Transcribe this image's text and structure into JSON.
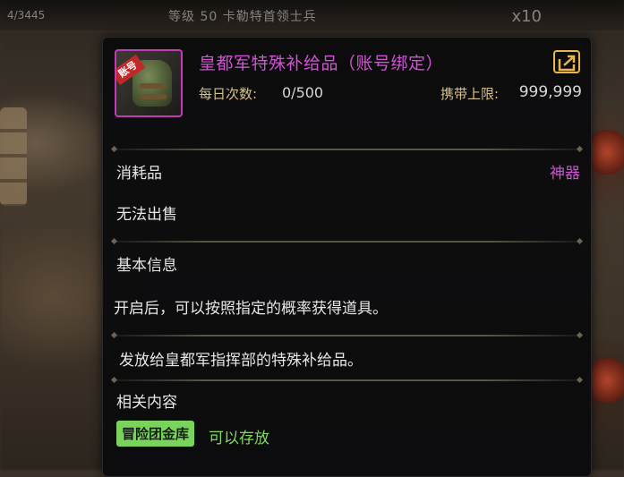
{
  "background": {
    "top_left_text": "4/3445",
    "top_center_text": "等级 50 卡勒特首领士兵",
    "top_right_text": "x10"
  },
  "item": {
    "icon_name": "backpack-icon",
    "tag": "账号",
    "title": "皇都军特殊补给品（账号绑定）",
    "title_color": "#d152d6",
    "daily_label": "每日次数:",
    "daily_value": "0/500",
    "carry_label": "携带上限:",
    "carry_value": "999,999"
  },
  "sections": {
    "type": "消耗品",
    "rarity": "神器",
    "sell": "无法出售",
    "basic_info_header": "基本信息",
    "basic_info_text": "开启后，可以按照指定的概率获得道具。",
    "description": "发放给皇都军指挥部的特殊补给品。",
    "related_header": "相关内容",
    "related_badge": "冒险团金库",
    "related_status": "可以存放"
  },
  "colors": {
    "accent_purple": "#d152d6",
    "label_gold": "#d4c08a",
    "green": "#79d35c",
    "share_icon": "#e8b64a"
  }
}
